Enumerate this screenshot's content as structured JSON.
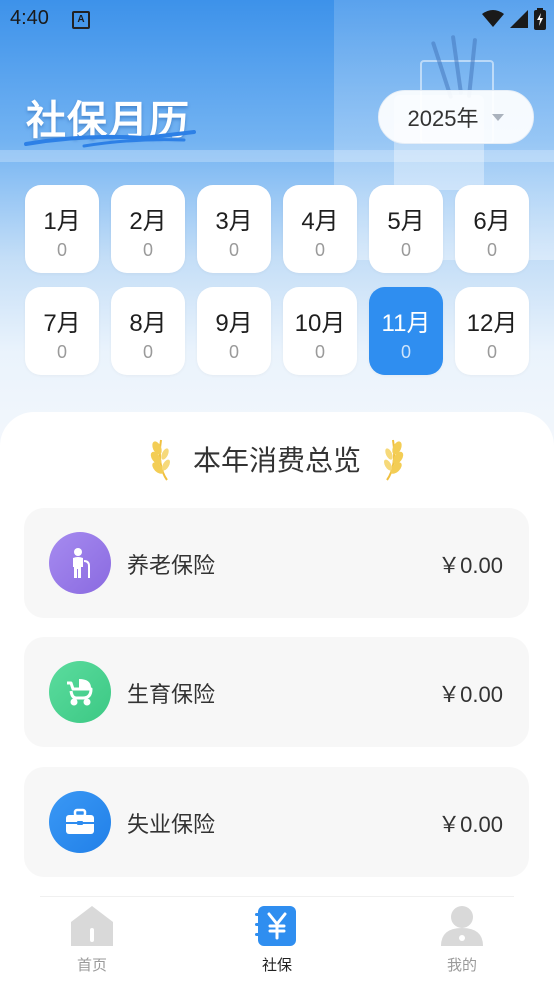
{
  "status_bar": {
    "time": "4:40",
    "notification_badge": "A"
  },
  "header": {
    "title": "社保月历",
    "year_selector": "2025年"
  },
  "months": [
    {
      "label": "1月",
      "count": "0"
    },
    {
      "label": "2月",
      "count": "0"
    },
    {
      "label": "3月",
      "count": "0"
    },
    {
      "label": "4月",
      "count": "0"
    },
    {
      "label": "5月",
      "count": "0"
    },
    {
      "label": "6月",
      "count": "0"
    },
    {
      "label": "7月",
      "count": "0"
    },
    {
      "label": "8月",
      "count": "0"
    },
    {
      "label": "9月",
      "count": "0"
    },
    {
      "label": "10月",
      "count": "0"
    },
    {
      "label": "11月",
      "count": "0"
    },
    {
      "label": "12月",
      "count": "0"
    }
  ],
  "selected_month": "11月",
  "overview": {
    "title": "本年消费总览",
    "items": [
      {
        "name": "养老保险",
        "amount": "￥0.00",
        "icon": "elderly-person-icon",
        "color": "#9a78e6"
      },
      {
        "name": "生育保险",
        "amount": "￥0.00",
        "icon": "baby-stroller-icon",
        "color": "#45cf8f"
      },
      {
        "name": "失业保险",
        "amount": "￥0.00",
        "icon": "briefcase-icon",
        "color": "#2d8cf0"
      }
    ]
  },
  "tabs": [
    {
      "label": "首页",
      "icon": "home-icon",
      "active": false
    },
    {
      "label": "社保",
      "icon": "yuan-book-icon",
      "active": true
    },
    {
      "label": "我的",
      "icon": "user-icon",
      "active": false
    }
  ],
  "colors": {
    "accent": "#2f8ef0",
    "gold": "#f0c040"
  }
}
